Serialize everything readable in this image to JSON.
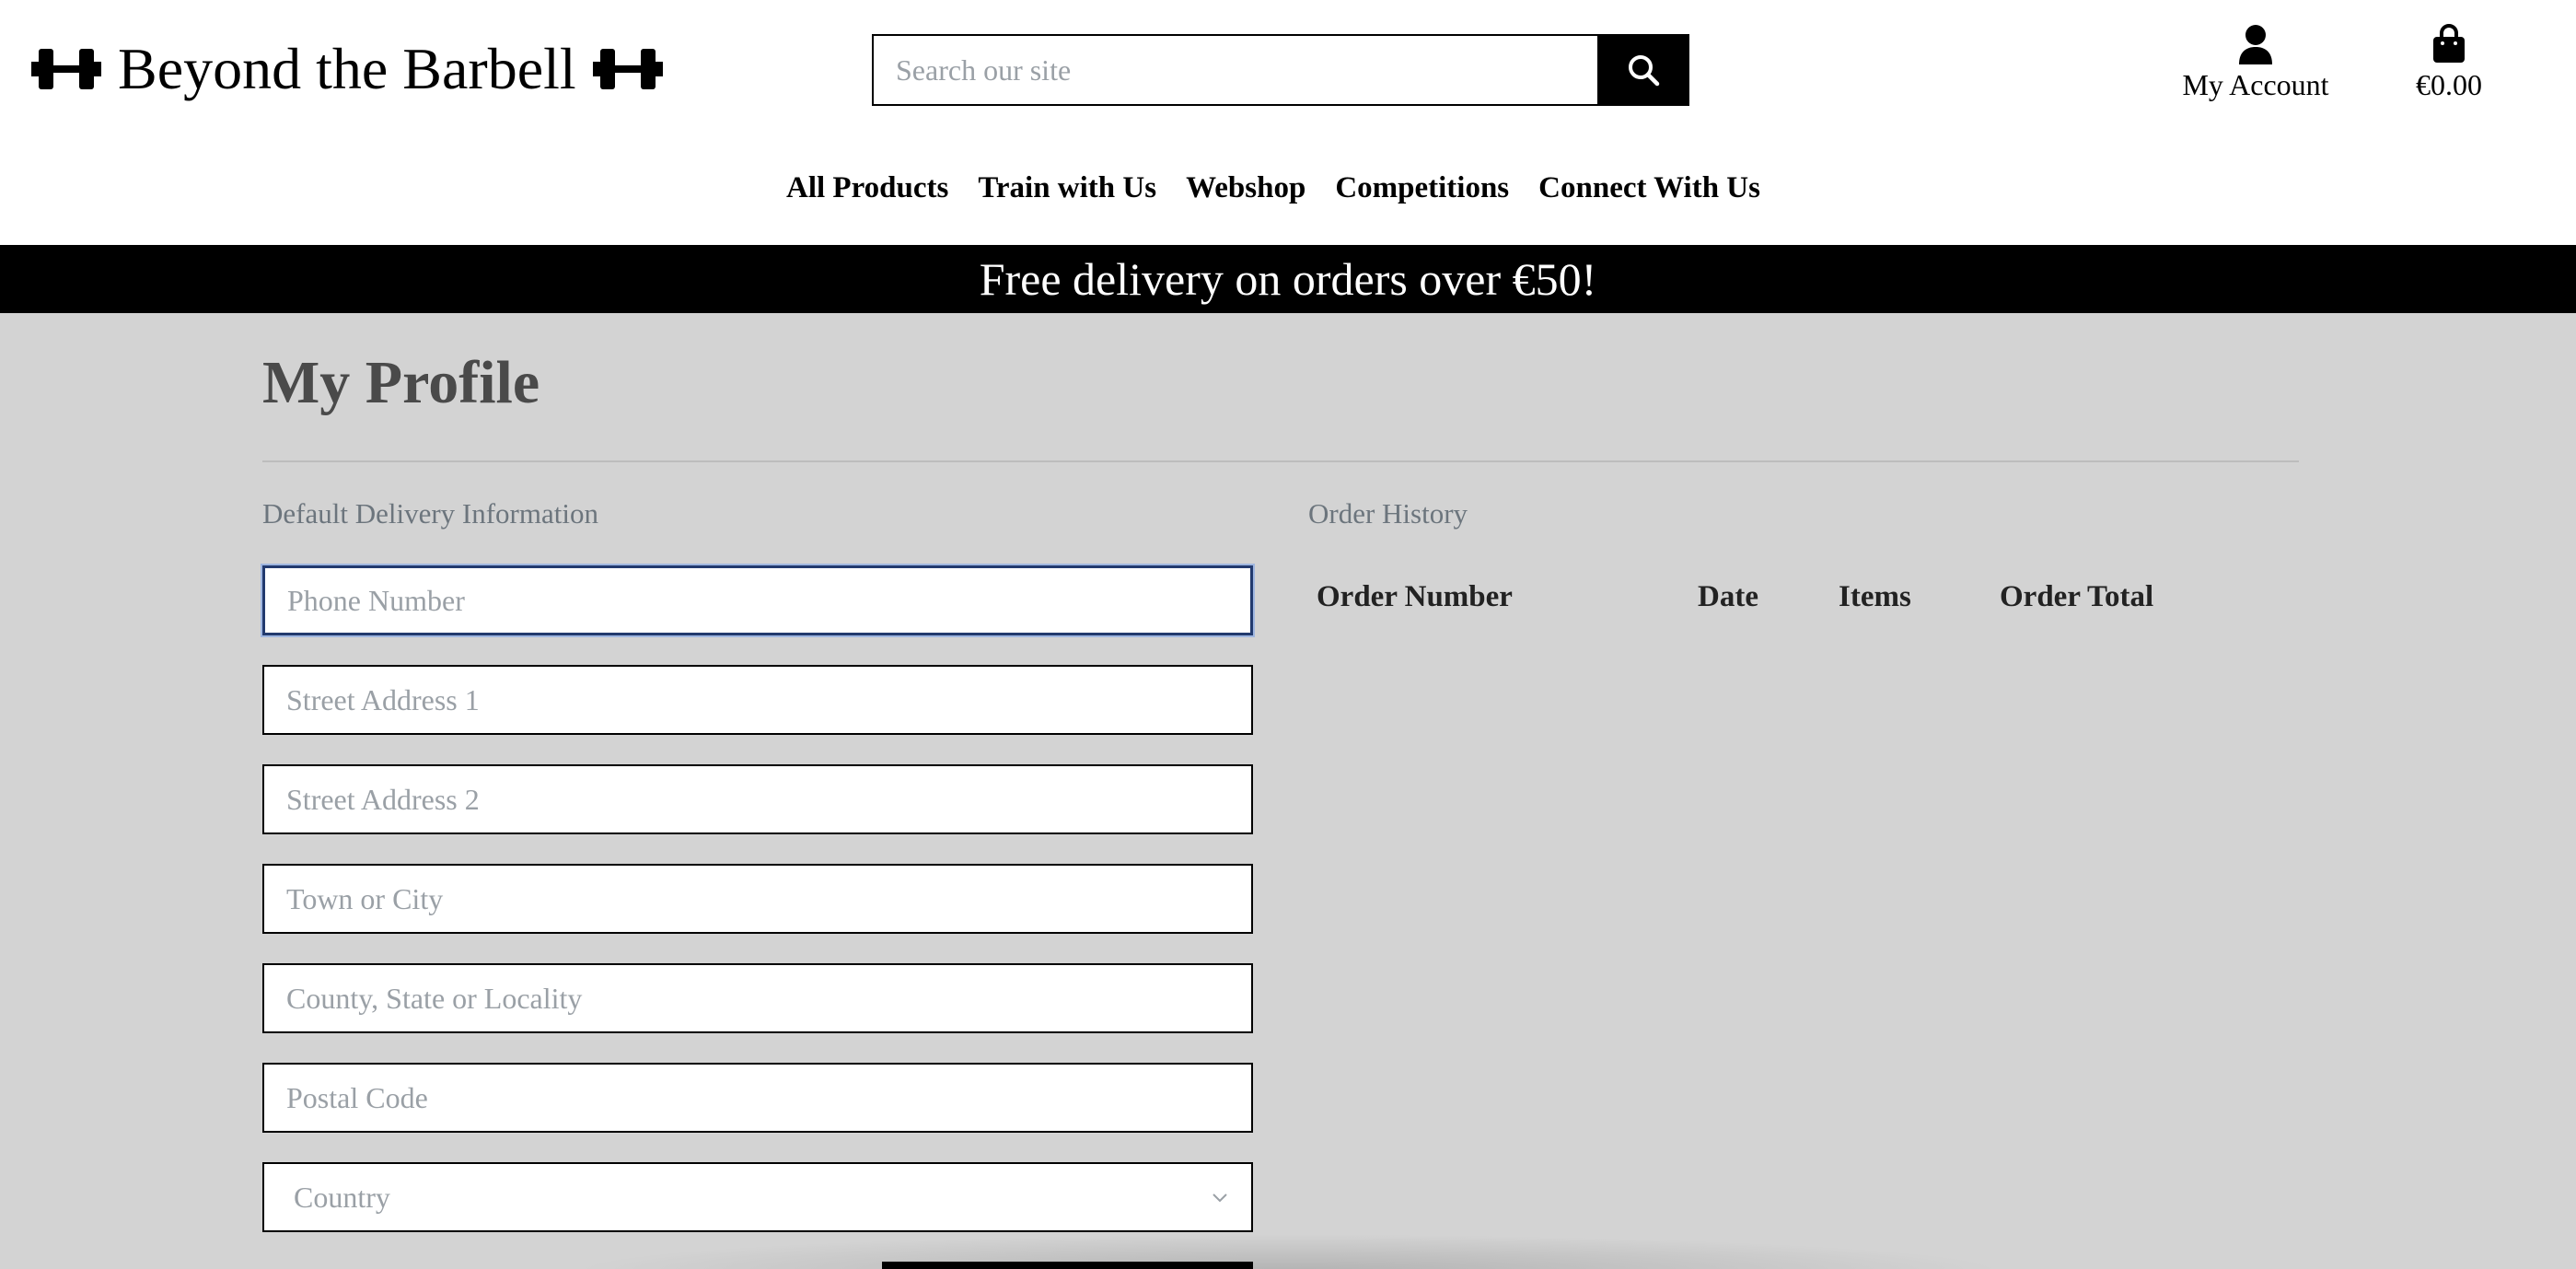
{
  "brand": {
    "name": "Beyond the Barbell",
    "icon": "dumbbell-icon"
  },
  "search": {
    "placeholder": "Search our site",
    "icon": "search-icon"
  },
  "account": {
    "label": "My Account",
    "icon": "user-icon"
  },
  "cart": {
    "total": "€0.00",
    "icon": "shopping-bag-icon"
  },
  "nav": {
    "items": [
      "All Products",
      "Train with Us",
      "Webshop",
      "Competitions",
      "Connect With Us"
    ]
  },
  "banner": {
    "text": "Free delivery on orders over €50!"
  },
  "page": {
    "title": "My Profile"
  },
  "delivery": {
    "heading": "Default Delivery Information",
    "fields": {
      "phone": "Phone Number",
      "street1": "Street Address 1",
      "street2": "Street Address 2",
      "town": "Town or City",
      "county": "County, State or Locality",
      "postcode": "Postal Code",
      "country": "Country"
    }
  },
  "orders": {
    "heading": "Order History",
    "columns": [
      "Order Number",
      "Date",
      "Items",
      "Order Total"
    ]
  },
  "colors": {
    "banner_bg": "#000000",
    "content_bg": "#d3d3d3",
    "focus_border": "#223a6e"
  }
}
